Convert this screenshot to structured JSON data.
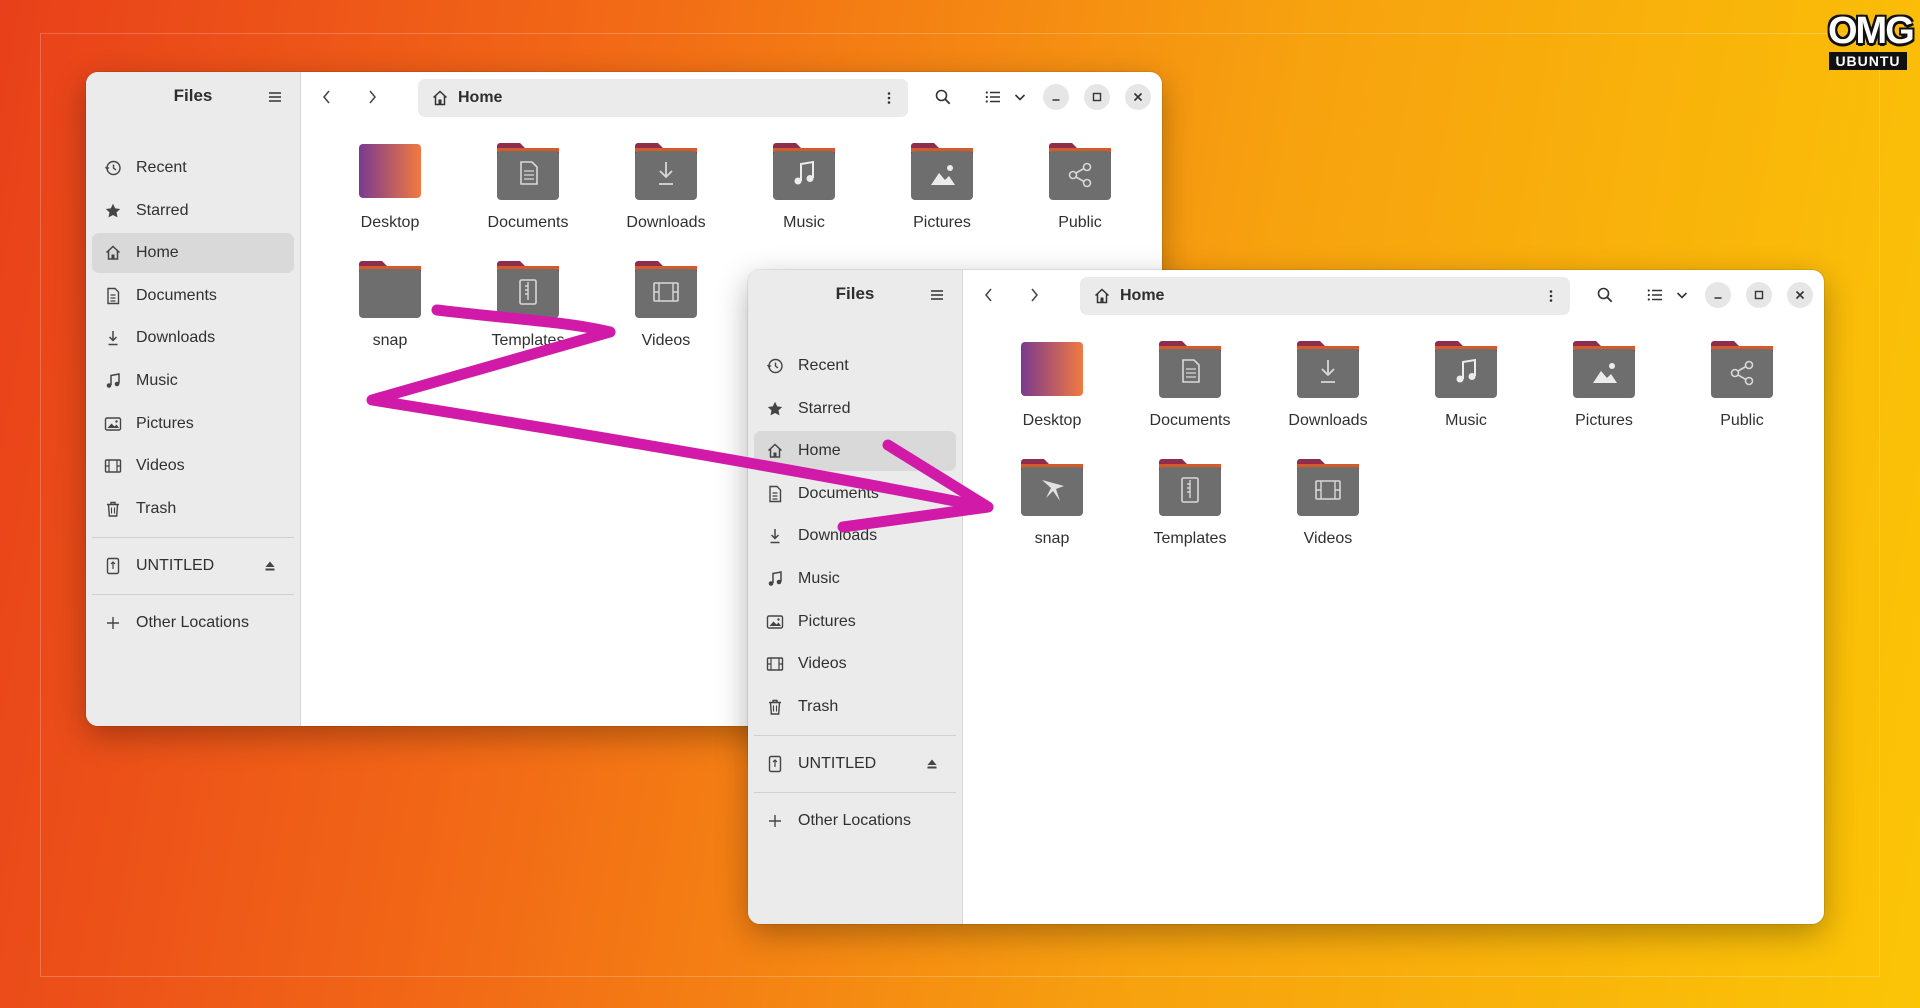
{
  "badge": {
    "line1": "OMG",
    "line2": "UBUNTU"
  },
  "window_a": {
    "sidebar": {
      "title": "Files",
      "items": [
        {
          "label": "Recent",
          "icon": "clock-icon"
        },
        {
          "label": "Starred",
          "icon": "star-icon"
        },
        {
          "label": "Home",
          "icon": "home-icon",
          "active": true
        },
        {
          "label": "Documents",
          "icon": "document-icon"
        },
        {
          "label": "Downloads",
          "icon": "download-icon"
        },
        {
          "label": "Music",
          "icon": "music-icon"
        },
        {
          "label": "Pictures",
          "icon": "picture-icon"
        },
        {
          "label": "Videos",
          "icon": "film-icon"
        },
        {
          "label": "Trash",
          "icon": "trash-icon"
        }
      ],
      "device": "UNTITLED",
      "other": "Other Locations"
    },
    "path": "Home",
    "files": [
      "Desktop",
      "Documents",
      "Downloads",
      "Music",
      "Pictures",
      "Public",
      "snap",
      "Templates",
      "Videos"
    ]
  },
  "window_b": {
    "sidebar": {
      "title": "Files",
      "items": [
        {
          "label": "Recent",
          "icon": "clock-icon"
        },
        {
          "label": "Starred",
          "icon": "star-icon"
        },
        {
          "label": "Home",
          "icon": "home-icon",
          "active": true
        },
        {
          "label": "Documents",
          "icon": "document-icon"
        },
        {
          "label": "Downloads",
          "icon": "download-icon"
        },
        {
          "label": "Music",
          "icon": "music-icon"
        },
        {
          "label": "Pictures",
          "icon": "picture-icon"
        },
        {
          "label": "Videos",
          "icon": "film-icon"
        },
        {
          "label": "Trash",
          "icon": "trash-icon"
        }
      ],
      "device": "UNTITLED",
      "other": "Other Locations"
    },
    "path": "Home",
    "files": [
      "Desktop",
      "Documents",
      "Downloads",
      "Music",
      "Pictures",
      "Public",
      "snap",
      "Templates",
      "Videos"
    ]
  },
  "colors": {
    "folder_top": "#8f2d4e",
    "folder_body": "#6e6e6e",
    "desktop_from": "#7a3a8f",
    "desktop_to": "#f07a40",
    "annotation_arrow": "#d21aa8"
  }
}
